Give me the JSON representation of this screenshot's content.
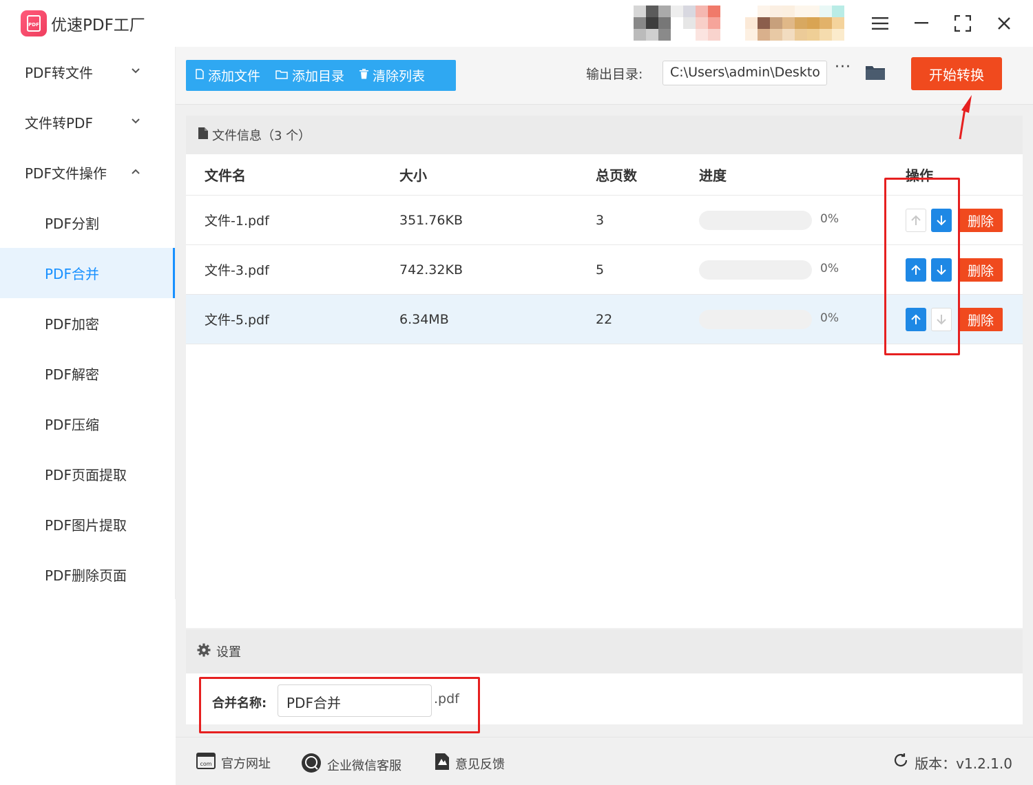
{
  "app": {
    "title": "优速PDF工厂",
    "logo_text": "PDF"
  },
  "window": {
    "menu_icon": "menu-icon",
    "minimize_icon": "minimize-icon",
    "maximize_icon": "maximize-icon",
    "close_icon": "close-icon"
  },
  "sidebar": {
    "groups": [
      {
        "label": "PDF转文件",
        "expanded": false
      },
      {
        "label": "文件转PDF",
        "expanded": false
      },
      {
        "label": "PDF文件操作",
        "expanded": true
      }
    ],
    "items": [
      {
        "label": "PDF分割"
      },
      {
        "label": "PDF合并",
        "active": true
      },
      {
        "label": "PDF加密"
      },
      {
        "label": "PDF解密"
      },
      {
        "label": "PDF压缩"
      },
      {
        "label": "PDF页面提取"
      },
      {
        "label": "PDF图片提取"
      },
      {
        "label": "PDF删除页面"
      }
    ]
  },
  "toolbar": {
    "add_file": "添加文件",
    "add_folder": "添加目录",
    "clear_list": "清除列表",
    "output_label": "输出目录:",
    "output_path": "C:\\Users\\admin\\Deskto",
    "more": "···",
    "start": "开始转换"
  },
  "file_panel": {
    "title": "文件信息（3 个）",
    "columns": [
      "文件名",
      "大小",
      "总页数",
      "进度",
      "操作"
    ],
    "rows": [
      {
        "name": "文件-1.pdf",
        "size": "351.76KB",
        "pages": "3",
        "progress": "0%",
        "progress_value": 0,
        "up_enabled": false,
        "down_enabled": true,
        "delete": "删除"
      },
      {
        "name": "文件-3.pdf",
        "size": "742.32KB",
        "pages": "5",
        "progress": "0%",
        "progress_value": 0,
        "up_enabled": true,
        "down_enabled": true,
        "delete": "删除"
      },
      {
        "name": "文件-5.pdf",
        "size": "6.34MB",
        "pages": "22",
        "progress": "0%",
        "progress_value": 0,
        "up_enabled": true,
        "down_enabled": false,
        "delete": "删除"
      }
    ]
  },
  "settings": {
    "title": "设置",
    "merge_label": "合并名称:",
    "merge_value": "PDF合并",
    "merge_ext": ".pdf"
  },
  "footer": {
    "website": "官方网址",
    "wechat": "企业微信客服",
    "feedback": "意见反馈",
    "version": "版本：v1.2.1.0"
  },
  "colors": {
    "accent": "#2fa8f2",
    "primary_blue": "#1e88e5",
    "danger": "#f04a1e",
    "highlight": "#e62020"
  }
}
